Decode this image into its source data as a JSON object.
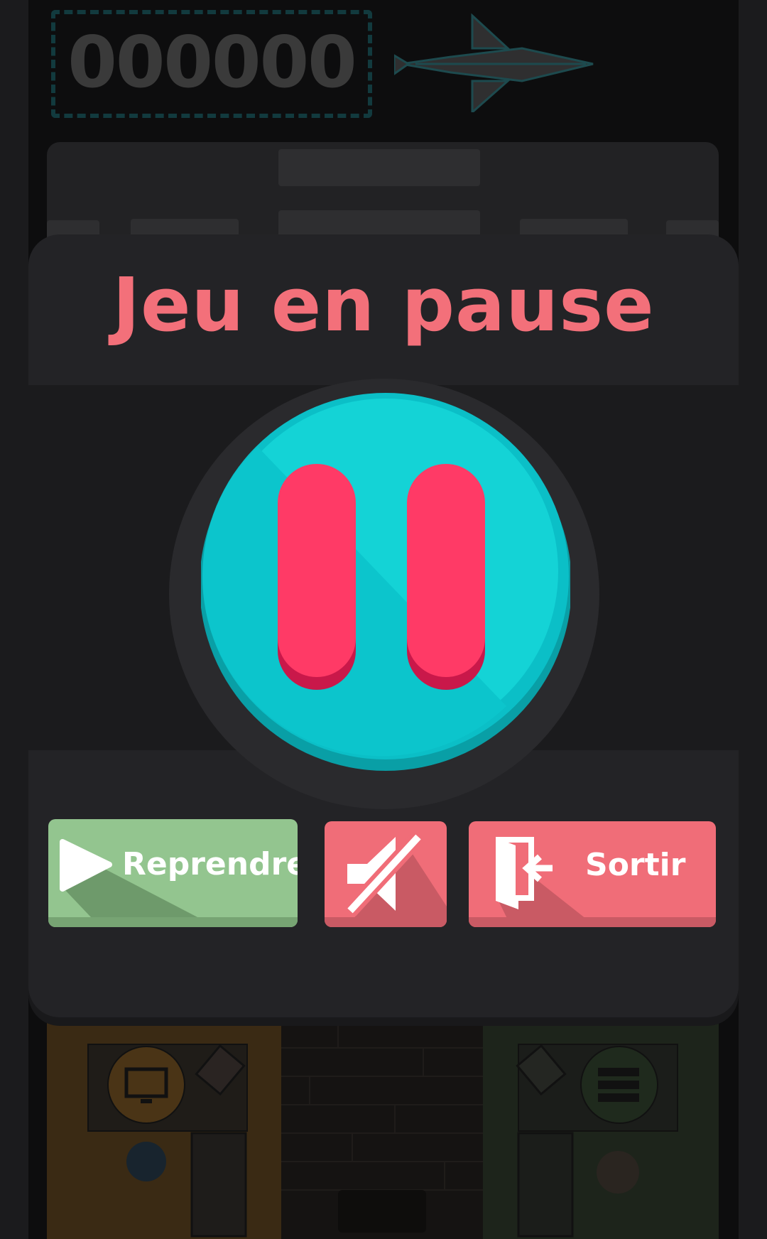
{
  "hud": {
    "score": "000000",
    "plane_icon": "paper-plane-icon"
  },
  "pause_menu": {
    "title": "Jeu en pause",
    "center_icon": "pause-icon",
    "buttons": {
      "resume": {
        "label": "Reprendre",
        "icon": "play-icon"
      },
      "mute": {
        "icon": "sound-off-icon"
      },
      "exit": {
        "label": "Sortir",
        "icon": "exit-door-icon"
      }
    }
  },
  "colors": {
    "title": "#f3707a",
    "resume_button": "#93c58f",
    "danger_button": "#f06d78",
    "pause_circle": "#0cc3cb",
    "pause_bars": "#ff3b66",
    "modal_bg": "#232326"
  }
}
